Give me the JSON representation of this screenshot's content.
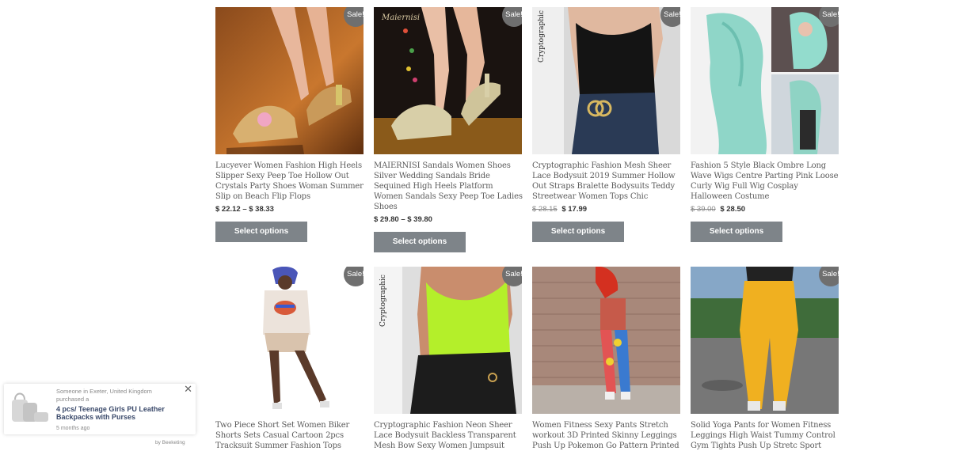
{
  "sale_label": "Sale!",
  "select_label": "Select options",
  "products": [
    {
      "title": "Lucyever Women Fashion High Heels Slipper Sexy Peep Toe Hollow Out Crystals Party Shoes Woman Summer Slip on Beach Flip Flops",
      "price_old": "",
      "price": "$ 22.12 – $ 38.33"
    },
    {
      "title": "MAIERNISI Sandals Women Shoes Silver Wedding Sandals Bride Sequined High Heels Platform Women Sandals Sexy Peep Toe Ladies Shoes",
      "price_old": "",
      "price": "$ 29.80 – $ 39.80",
      "image_text": "Maiernisi"
    },
    {
      "title": "Cryptographic Fashion Mesh Sheer Lace Bodysuit 2019 Summer Hollow Out Straps Bralette Bodysuits Teddy Streetwear Women Tops Chic",
      "price_old": "$ 28.15",
      "price": "$ 17.99",
      "image_text": "Cryptographic"
    },
    {
      "title": "Fashion 5 Style Black Ombre Long Wave Wigs Centre Parting Pink Loose Curly Wig Full Wig Cosplay Halloween Costume",
      "price_old": "$ 39.00",
      "price": "$ 28.50"
    },
    {
      "title": "Two Piece Short Set Women Biker Shorts Sets Casual Cartoon 2pcs Tracksuit Summer Fashion Tops Short Pants"
    },
    {
      "title": "Cryptographic Fashion Neon Sheer Lace Bodysuit Backless Transparent Mesh Bow Sexy Women Jumpsuit Straps bodysuits",
      "image_text": "Cryptographic"
    },
    {
      "title": "Women Fitness Sexy Pants Stretch workout 3D Printed Skinny Leggings Push Up Pokemon Go Pattern Printed"
    },
    {
      "title": "Solid Yoga Pants for Women Fitness Leggings High Waist Tummy Control Gym Tights Push Up Stretc Sport"
    }
  ],
  "notification": {
    "line1": "Someone in Exeter, United Kingdom",
    "line2": "purchased a",
    "product": "4 pcs/ Teenage Girls PU Leather Backpacks with Purses",
    "time": "5 months ago",
    "close": "✕",
    "credit": "by Beeketing"
  },
  "colors": {
    "sale_badge": "#6f6f6f",
    "button": "#7e8489",
    "title_text": "#5b5b5b"
  },
  "icons": {
    "notification_close": "close-icon"
  }
}
